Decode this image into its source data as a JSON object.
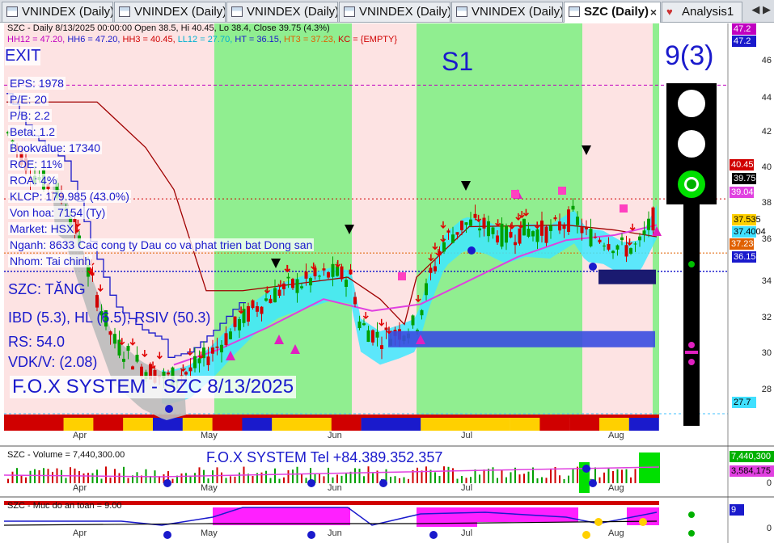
{
  "tabs": [
    {
      "label": "VNINDEX (Daily)",
      "active": false
    },
    {
      "label": "VNINDEX (Daily)",
      "active": false
    },
    {
      "label": "VNINDEX (Daily)",
      "active": false
    },
    {
      "label": "VNINDEX (Daily)",
      "active": false
    },
    {
      "label": "VNINDEX (Daily)",
      "active": false
    },
    {
      "label": "SZC (Daily)",
      "active": true
    },
    {
      "label": "Analysis1",
      "active": false
    }
  ],
  "tab_close": "×",
  "header": {
    "line1": "SZC - Daily 8/13/2025 00:00:00 Open 38.5, Hi 40.45, Lo 38.4, Close 39.75 (4.3%)",
    "line2": [
      {
        "text": "HH12 = 47.20, ",
        "color": "#c000c0"
      },
      {
        "text": "HH6 = 47.20, ",
        "color": "#1a1acc"
      },
      {
        "text": "HH3 = 40.45, ",
        "color": "#d00000"
      },
      {
        "text": "LL12 = 27.70, ",
        "color": "#00b0d0"
      },
      {
        "text": "HT = 36.15, ",
        "color": "#1a1acc"
      },
      {
        "text": "HT3 = 37.23, ",
        "color": "#e06000"
      },
      {
        "text": "KC = {EMPTY}",
        "color": "#d00000"
      }
    ]
  },
  "overlay": {
    "exit": "EXIT",
    "s1": "S1",
    "counter": "9(3)",
    "fundamentals": [
      "EPS: 1978",
      "P/E: 20",
      "P/B: 2.2",
      "Beta: 1.2",
      "Bookvalue: 17340",
      "ROE: 11%",
      "ROA: 4%",
      "KLCP: 179.985 (43.0%)",
      "Von hoa: 7154 (Ty)",
      "Market: HSX",
      "Nganh: 8633 Cac cong ty Dau co va phat trien bat Dong san",
      "Nhom: Tai chinh"
    ],
    "signals": [
      "SZC: TĂNG",
      "IBD (5.3), HL (6.5), RSIV (50.3)",
      "RS: 54.0",
      "VDK/V:  (2.08)"
    ],
    "system_title": "F.O.X SYSTEM - SZC 8/13/2025",
    "system_tel": "F.O.X SYSTEM Tel +84.389.352.357"
  },
  "price_axis": {
    "ticks": [
      "46",
      "44",
      "42",
      "40",
      "38",
      "36",
      "34",
      "32",
      "30",
      "28"
    ],
    "boxes": [
      {
        "text": "47.2",
        "bg": "#c000c0",
        "fg": "#fff"
      },
      {
        "text": "47.2",
        "bg": "#1a1acc",
        "fg": "#fff"
      },
      {
        "text": "40.45",
        "bg": "#d00000",
        "fg": "#fff"
      },
      {
        "text": "39.75",
        "bg": "#000",
        "fg": "#fff"
      },
      {
        "text": "39.0403",
        "bg": "#e040e0",
        "fg": "#fff"
      },
      {
        "text": "37.535",
        "bg": "#ffd000",
        "fg": "#000"
      },
      {
        "text": "37.4004",
        "bg": "#40e0ff",
        "fg": "#000"
      },
      {
        "text": "37.2345",
        "bg": "#e06000",
        "fg": "#fff"
      },
      {
        "text": "36.15",
        "bg": "#1a1acc",
        "fg": "#fff"
      },
      {
        "text": "27.7",
        "bg": "#40e0ff",
        "fg": "#000"
      }
    ]
  },
  "months": [
    "Apr",
    "May",
    "Jun",
    "Jul",
    "Aug"
  ],
  "volume": {
    "title": "SZC - Volume = 7,440,300.00",
    "boxes": [
      {
        "text": "7,440,300",
        "bg": "#00b000",
        "fg": "#fff"
      },
      {
        "text": "3,584,175",
        "bg": "#e040e0",
        "fg": "#000"
      }
    ],
    "zero": "0"
  },
  "safety": {
    "title": "SZC - Muc do an toan = 9.00",
    "box": {
      "text": "9",
      "bg": "#1a1acc",
      "fg": "#fff"
    },
    "zero": "0"
  },
  "colors": {
    "green_zone": "#90ee90",
    "pink_zone": "#fde3e3",
    "accent": "#1a1acc"
  },
  "icons": [
    "chart-tab-icon",
    "analysis-tab-icon",
    "close-icon",
    "nav-arrow-icon",
    "traffic-light-icon"
  ]
}
